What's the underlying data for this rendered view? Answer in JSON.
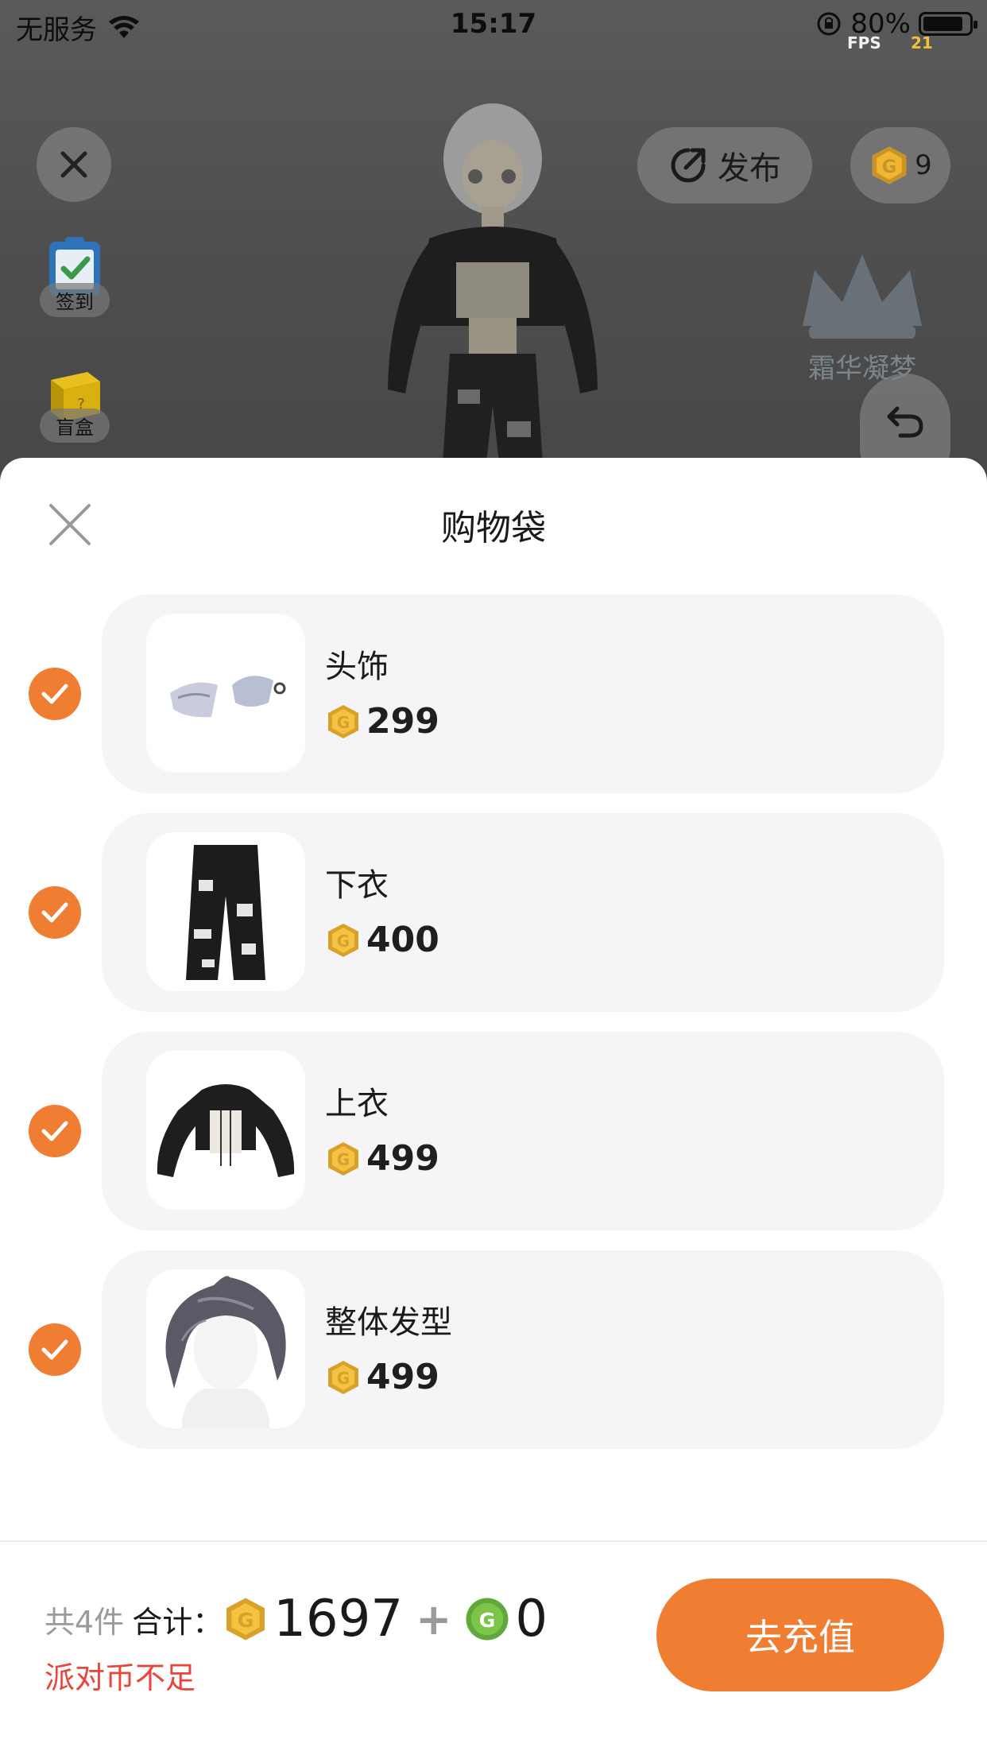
{
  "status_bar": {
    "carrier": "无服务",
    "time": "15:17",
    "battery": "80%",
    "battery_level": 0.8,
    "fps_label": "FPS",
    "fps_value": "21"
  },
  "scene": {
    "publish_label": "发布",
    "coin_balance": "9",
    "sign_in_label": "签到",
    "blind_box_label": "盲盒",
    "watermark": "霜华凝梦"
  },
  "sheet": {
    "title": "购物袋",
    "items": [
      {
        "name": "头饰",
        "price": "299",
        "checked": true
      },
      {
        "name": "下衣",
        "price": "400",
        "checked": true
      },
      {
        "name": "上衣",
        "price": "499",
        "checked": true
      },
      {
        "name": "整体发型",
        "price": "499",
        "checked": true
      }
    ]
  },
  "footer": {
    "count_text": "共4件",
    "total_label": "合计：",
    "gold_total": "1697",
    "plus": "+",
    "green_total": "0",
    "warning": "派对币不足",
    "recharge_label": "去充值"
  },
  "colors": {
    "accent": "#ef7d32",
    "warning": "#e8453c",
    "gold_coin": "#f2b530",
    "green_coin": "#7cc54a"
  }
}
